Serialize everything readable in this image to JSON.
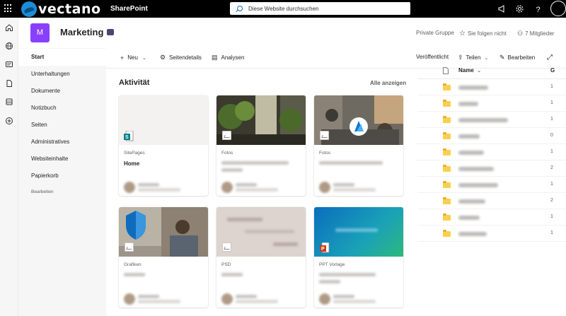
{
  "suite": {
    "brand": "vectano",
    "app_name": "SharePoint",
    "search_placeholder": "Diese Website durchsuchen"
  },
  "site": {
    "logo_letter": "M",
    "title": "Marketing",
    "privacy": "Private Gruppe",
    "follow_label": "Sie folgen nicht",
    "members_label": "7 Mitglieder"
  },
  "nav": {
    "items": [
      {
        "label": "Start",
        "active": true
      },
      {
        "label": "Unterhaltungen"
      },
      {
        "label": "Dokumente"
      },
      {
        "label": "Notizbuch"
      },
      {
        "label": "Seiten"
      },
      {
        "label": "Administratives"
      },
      {
        "label": "Websiteinhalte"
      },
      {
        "label": "Papierkorb"
      }
    ],
    "edit_label": "Bearbeiten"
  },
  "command_bar": {
    "new_label": "Neu",
    "page_details_label": "Seitendetails",
    "analytics_label": "Analysen",
    "published_label": "Veröffentlicht",
    "share_label": "Teilen",
    "edit_label": "Bearbeiten"
  },
  "activity": {
    "title": "Aktivität",
    "show_all": "Alle anzeigen",
    "cards": [
      {
        "type": "SitePages",
        "title": "Home"
      },
      {
        "type": "Fotos",
        "title": ""
      },
      {
        "type": "Fotos",
        "title": ""
      },
      {
        "type": "Grafiken",
        "title": ""
      },
      {
        "type": "PSD",
        "title": ""
      },
      {
        "type": "PPT Vorlage",
        "title": ""
      }
    ]
  },
  "library": {
    "name_header": "Name",
    "col2_header": "G",
    "row_numbers": [
      "1",
      "1",
      "1",
      "0",
      "1",
      "2",
      "1",
      "2",
      "1",
      "1"
    ]
  },
  "colors": {
    "site_logo": "#8a3ffc",
    "brand_blue": "#1b8fd6",
    "folder": "#f8d04e"
  }
}
